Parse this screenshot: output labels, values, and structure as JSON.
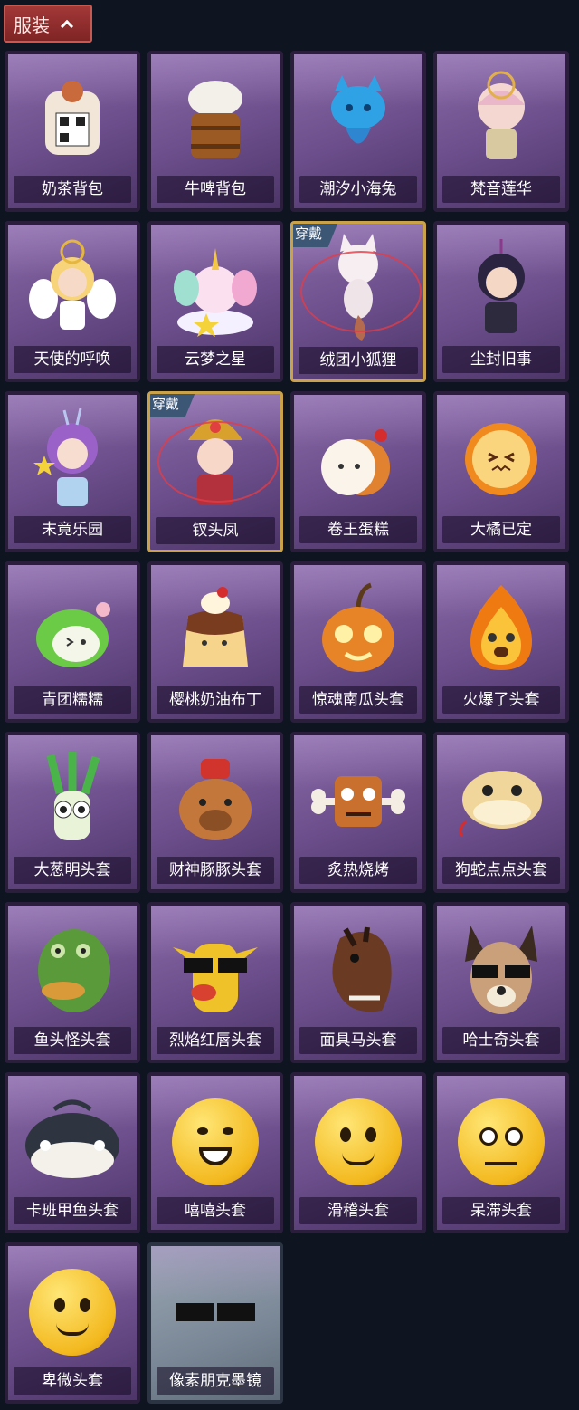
{
  "header": {
    "title": "服装",
    "icon": "chevron-up-icon"
  },
  "cards": [
    {
      "label": "奶茶背包",
      "art": "milk-tea-backpack"
    },
    {
      "label": "牛啤背包",
      "art": "beer-barrel-backpack"
    },
    {
      "label": "潮汐小海兔",
      "art": "blue-sea-bunny"
    },
    {
      "label": "梵音莲华",
      "art": "lotus-figure"
    },
    {
      "label": "天使的呼唤",
      "art": "angel-doll"
    },
    {
      "label": "云梦之星",
      "art": "unicorn-cloud"
    },
    {
      "label": "绒团小狐狸",
      "art": "white-fox",
      "badge": "穿戴"
    },
    {
      "label": "尘封旧事",
      "art": "dark-hair-boy"
    },
    {
      "label": "末竟乐园",
      "art": "purple-hair-girl"
    },
    {
      "label": "钗头凤",
      "art": "phoenix-crown-doll",
      "badge": "穿戴"
    },
    {
      "label": "卷王蛋糕",
      "art": "roll-cake"
    },
    {
      "label": "大橘已定",
      "art": "orange-slice"
    },
    {
      "label": "青团糯糯",
      "art": "green-rice-ball"
    },
    {
      "label": "樱桃奶油布丁",
      "art": "pudding"
    },
    {
      "label": "惊魂南瓜头套",
      "art": "pumpkin-head"
    },
    {
      "label": "火爆了头套",
      "art": "fire-head"
    },
    {
      "label": "大葱明头套",
      "art": "green-onion-head"
    },
    {
      "label": "财神豚豚头套",
      "art": "capybara-head"
    },
    {
      "label": "炙热烧烤",
      "art": "bbq-meat"
    },
    {
      "label": "狗蛇点点头套",
      "art": "snake-head"
    },
    {
      "label": "鱼头怪头套",
      "art": "fish-head"
    },
    {
      "label": "烈焰红唇头套",
      "art": "pikachu-head"
    },
    {
      "label": "面具马头套",
      "art": "horse-head"
    },
    {
      "label": "哈士奇头套",
      "art": "husky-head"
    },
    {
      "label": "卡班甲鱼头套",
      "art": "whale-head"
    },
    {
      "label": "嘻嘻头套",
      "art": "grin-emoji"
    },
    {
      "label": "滑稽头套",
      "art": "funny-emoji"
    },
    {
      "label": "呆滞头套",
      "art": "dazed-emoji"
    },
    {
      "label": "卑微头套",
      "art": "humble-emoji"
    },
    {
      "label": "像素朋克墨镜",
      "art": "pixel-sunglasses",
      "grey": true
    }
  ]
}
